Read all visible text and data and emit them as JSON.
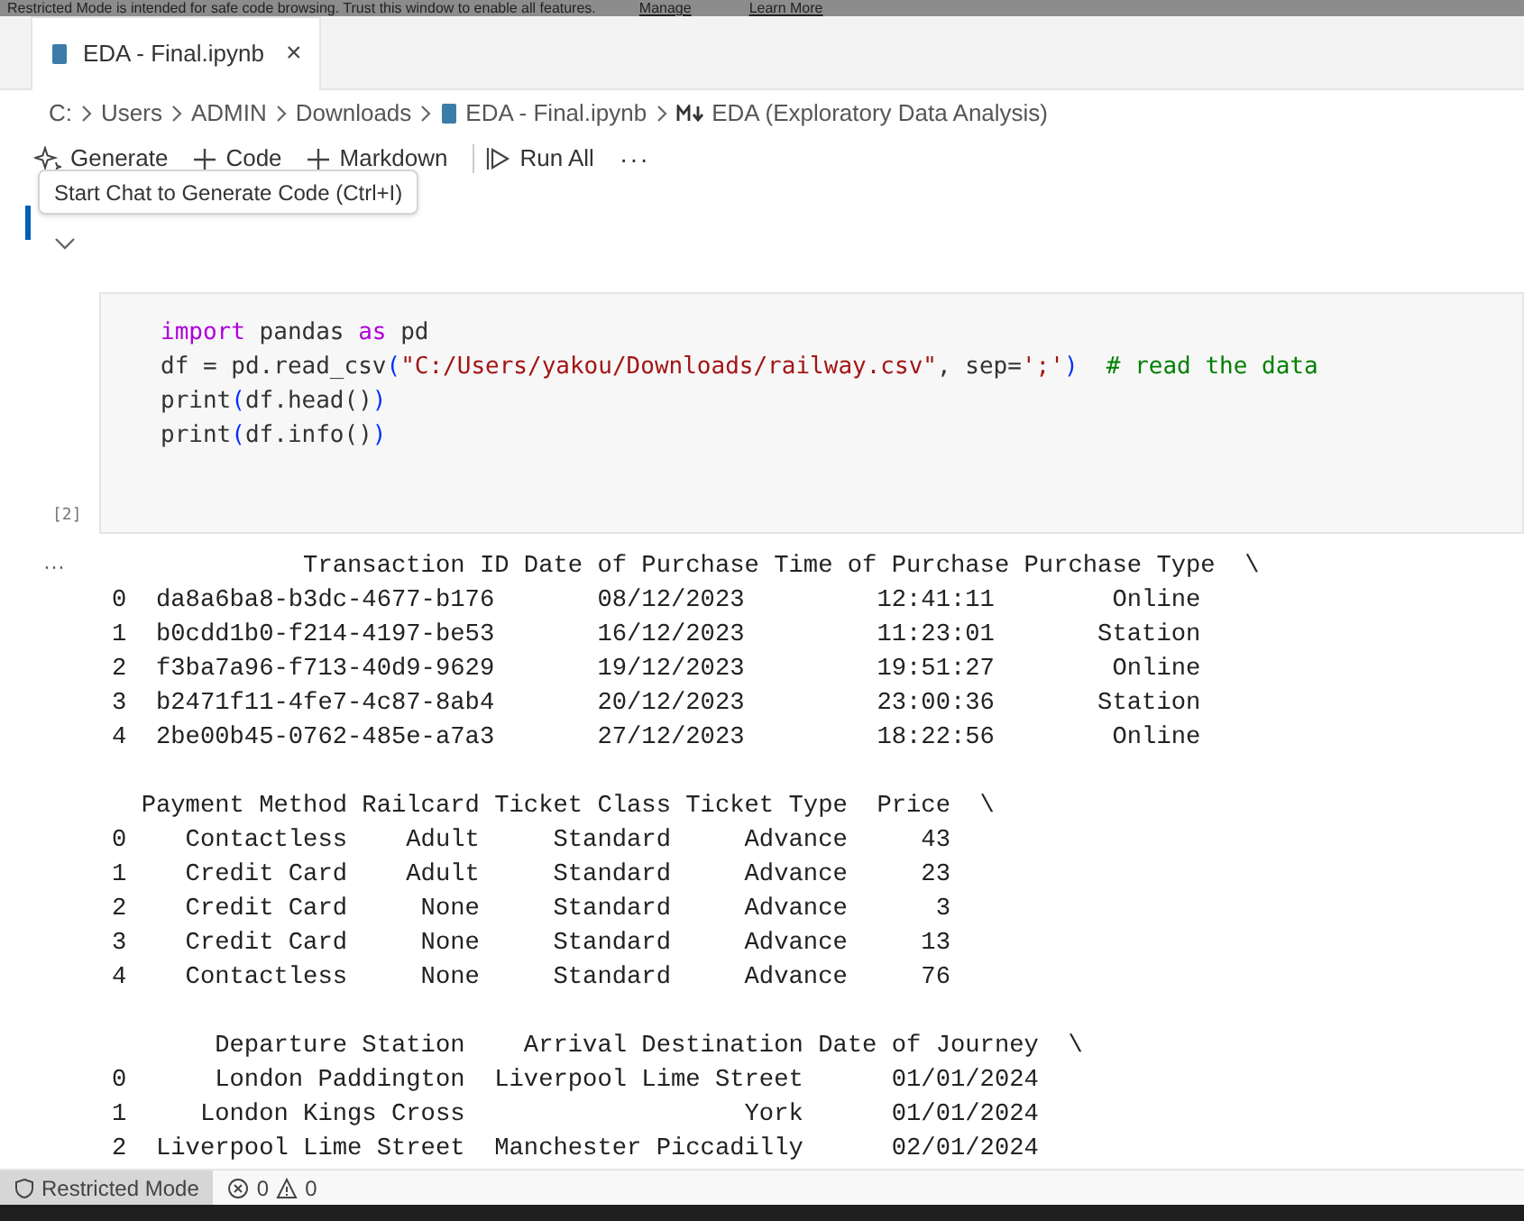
{
  "banner": {
    "text": "Restricted Mode is intended for safe code browsing. Trust this window to enable all features.",
    "links": [
      "Manage",
      "Learn More"
    ]
  },
  "tabs": [
    {
      "label": "EDA - Final.ipynb",
      "selected": true,
      "close": "×"
    }
  ],
  "breadcrumbs": [
    {
      "label": "C:",
      "kind": "folder"
    },
    {
      "label": "Users",
      "kind": "folder"
    },
    {
      "label": "ADMIN",
      "kind": "folder"
    },
    {
      "label": "Downloads",
      "kind": "folder"
    },
    {
      "label": "EDA - Final.ipynb",
      "kind": "notebook"
    },
    {
      "label": "EDA (Exploratory Data Analysis)",
      "kind": "markdown"
    }
  ],
  "toolbar": [
    {
      "label": "Generate",
      "kind": "sparkle"
    },
    {
      "label": "Code",
      "kind": "plus"
    },
    {
      "label": "Markdown",
      "kind": "plus"
    },
    {
      "label": "Run All",
      "kind": "run"
    },
    {
      "label": "···",
      "kind": "more"
    }
  ],
  "tooltip": "Start Chat to Generate Code (Ctrl+I)",
  "code_cell": {
    "execution_count": "[2]",
    "lines": [
      [
        {
          "text": "import",
          "kind": "keyword"
        },
        {
          "text": " pandas ",
          "kind": "plain"
        },
        {
          "text": "as",
          "kind": "keyword"
        },
        {
          "text": " pd",
          "kind": "plain"
        }
      ],
      [
        {
          "text": "df = pd.read_csv",
          "kind": "plain"
        },
        {
          "text": "(",
          "kind": "bracket"
        },
        {
          "text": "\"C:/Users/yakou/Downloads/railway.csv\"",
          "kind": "string"
        },
        {
          "text": ", sep=",
          "kind": "plain"
        },
        {
          "text": "';'",
          "kind": "string"
        },
        {
          "text": ")",
          "kind": "bracket"
        },
        {
          "text": "  # read the data",
          "kind": "comment"
        }
      ],
      [
        {
          "text": "print",
          "kind": "plain"
        },
        {
          "text": "(",
          "kind": "bracket"
        },
        {
          "text": "df.head()",
          "kind": "plain"
        },
        {
          "text": ")",
          "kind": "bracket"
        }
      ],
      [
        {
          "text": "print",
          "kind": "plain"
        },
        {
          "text": "(",
          "kind": "bracket"
        },
        {
          "text": "df.info()",
          "kind": "plain"
        },
        {
          "text": ")",
          "kind": "bracket"
        }
      ]
    ]
  },
  "output": {
    "more": "···",
    "blocks": [
      [
        "             Transaction ID Date of Purchase Time of Purchase Purchase Type  \\",
        "0  da8a6ba8-b3dc-4677-b176       08/12/2023         12:41:11        Online",
        "1  b0cdd1b0-f214-4197-be53       16/12/2023         11:23:01       Station",
        "2  f3ba7a96-f713-40d9-9629       19/12/2023         19:51:27        Online",
        "3  b2471f11-4fe7-4c87-8ab4       20/12/2023         23:00:36       Station",
        "4  2be00b45-0762-485e-a7a3       27/12/2023         18:22:56        Online"
      ],
      [
        "  Payment Method Railcard Ticket Class Ticket Type  Price  \\",
        "0    Contactless    Adult     Standard     Advance     43",
        "1    Credit Card    Adult     Standard     Advance     23",
        "2    Credit Card     None     Standard     Advance      3",
        "3    Credit Card     None     Standard     Advance     13",
        "4    Contactless     None     Standard     Advance     76"
      ],
      [
        "       Departure Station    Arrival Destination Date of Journey  \\",
        "0      London Paddington  Liverpool Lime Street      01/01/2024",
        "1     London Kings Cross                   York      01/01/2024",
        "2  Liverpool Lime Street  Manchester Piccadilly      02/01/2024"
      ]
    ]
  },
  "status_bar": {
    "mode": "Restricted Mode",
    "errors": "0",
    "warnings": "0"
  }
}
